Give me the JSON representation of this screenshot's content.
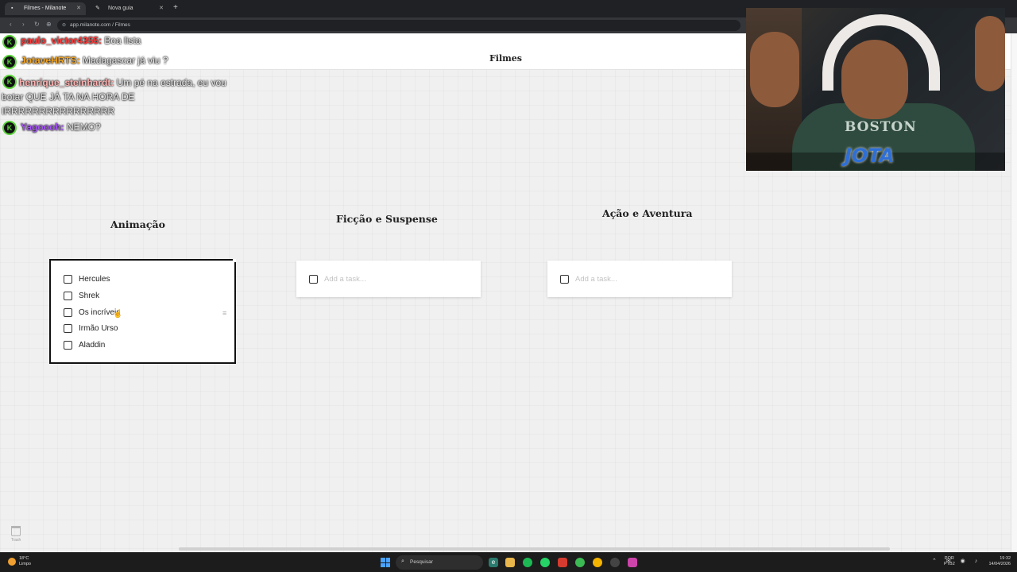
{
  "browser": {
    "tabs": [
      {
        "label": "Filmes - Milanote",
        "active": true
      },
      {
        "label": "Nova guia",
        "active": false
      }
    ],
    "new_tab_symbol": "+",
    "close_symbol": "✕",
    "url": "app.milanote.com / Filmes"
  },
  "board": {
    "title": "Filmes",
    "trash_label": "Trash"
  },
  "columns": [
    {
      "heading": "Animação",
      "tasks": [
        "Hercules",
        "Shrek",
        "Os incríveis",
        "Irmão Urso",
        "Aladdin"
      ]
    },
    {
      "heading": "Ficção e Suspense",
      "placeholder": "Add a task..."
    },
    {
      "heading": "Ação e Aventura",
      "placeholder": "Add a task..."
    }
  ],
  "chat": [
    {
      "name": "paulo_victor4355:",
      "message": "Boa lista",
      "color": "#ff3b3b"
    },
    {
      "name": "JotaveHRTS:",
      "message": "Madagascar já viu ?",
      "color": "#f5a623"
    },
    {
      "name": "henrique_steinhardt:",
      "message": "Um pé na estrada, eu vou botar QUE JÁ TA NA HORA DE IRRRRRRRRRRRRRRRR",
      "color": "#ffb3b3"
    },
    {
      "name": "Yagoooh:",
      "message": "NEMO?",
      "color": "#a855f7"
    }
  ],
  "chat_badge": "K",
  "webcam": {
    "shirt_text": "BOSTON",
    "logo_text": "JOTA"
  },
  "taskbar": {
    "weather_temp": "18°C",
    "weather_desc": "Limpo",
    "search_placeholder": "Pesquisar",
    "lang_top": "POR",
    "lang_bottom": "PTB2",
    "time": "19:32",
    "date": "14/04/2026"
  },
  "colors": {
    "accent_green": "#5ad33a",
    "windows_blue": "#4aa3ff"
  }
}
